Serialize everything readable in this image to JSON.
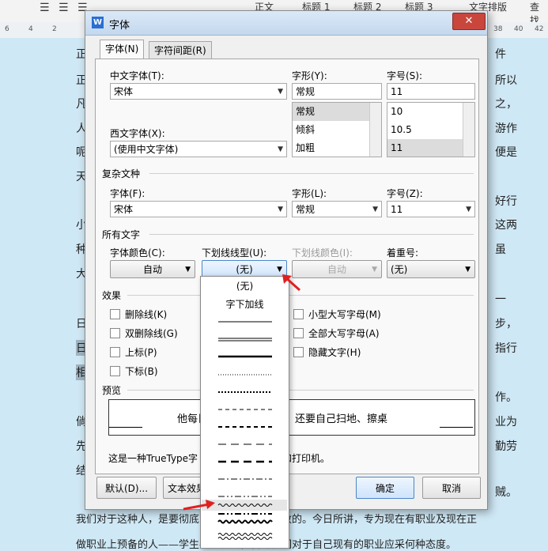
{
  "toolbar": {
    "items": [
      "正文",
      "标题 1",
      "标题 2",
      "标题 3",
      "文字排版",
      "查找"
    ]
  },
  "ruler": {
    "ticks": [
      "6",
      "4",
      "2",
      "38",
      "40",
      "42"
    ]
  },
  "document": {
    "left_lines": [
      {
        "text": "正"
      },
      {
        "text": "正"
      },
      {
        "text": "凡"
      },
      {
        "text": "人"
      },
      {
        "text": "呢"
      },
      {
        "text": "天"
      },
      {
        "text": "小"
      },
      {
        "text": "种"
      },
      {
        "text": "大"
      },
      {
        "text": "日"
      },
      {
        "text": "日"
      },
      {
        "text": "相"
      },
      {
        "text": "倘"
      },
      {
        "text": "先"
      },
      {
        "text": "结"
      }
    ],
    "right_lines": [
      "件",
      "所以",
      "之，",
      "游作",
      "便是",
      "好行",
      "这两",
      "虽",
      "一",
      "步，",
      "指行",
      "作。",
      "业为",
      "勤劳",
      "贼。"
    ],
    "bottom_line_1": "我们对于这种人，是要彻底的清算和大家要厦敦的。今日所讲，专为现在有职业及现在正",
    "bottom_line_2": "做职业上预备的人——学生——说法，告诉他们对于自己现有的职业应采何种态度。"
  },
  "dialog": {
    "title": "字体",
    "close": "✕",
    "tabs": [
      "字体(N)",
      "字符间距(R)"
    ],
    "chinese_font_label": "中文字体(T):",
    "chinese_font_value": "宋体",
    "style_label": "字形(Y):",
    "style_value": "常规",
    "style_options": [
      "常规",
      "倾斜",
      "加粗"
    ],
    "size_label": "字号(S):",
    "size_value": "11",
    "size_options": [
      "10",
      "10.5",
      "11"
    ],
    "western_font_label": "西文字体(X):",
    "western_font_value": "(使用中文字体)",
    "complex_section": "复杂文种",
    "complex_font_label": "字体(F):",
    "complex_font_value": "宋体",
    "complex_style_label": "字形(L):",
    "complex_style_value": "常规",
    "complex_size_label": "字号(Z):",
    "complex_size_value": "11",
    "all_text_section": "所有文字",
    "font_color_label": "字体颜色(C):",
    "font_color_value": "自动",
    "underline_type_label": "下划线线型(U):",
    "underline_type_value": "(无)",
    "underline_color_label": "下划线颜色(I):",
    "underline_color_value": "自动",
    "emphasis_label": "着重号:",
    "emphasis_value": "(无)",
    "effects_section": "效果",
    "effects_left": [
      "删除线(K)",
      "双删除线(G)",
      "上标(P)",
      "下标(B)"
    ],
    "effects_right": [
      "小型大写字母(M)",
      "全部大写字母(A)",
      "隐藏文字(H)"
    ],
    "preview_section": "预览",
    "preview_text": "他每日……，还要自己扫地、擦桌",
    "preview_text_left": "他每日",
    "preview_text_right": "，还要自己扫地、擦桌",
    "note_left": "这是一种TrueType字",
    "note_right": "和打印机。",
    "buttons": {
      "default": "默认(D)...",
      "text_effects": "文本效果",
      "ok": "确定",
      "cancel": "取消"
    }
  },
  "underline_dropdown": {
    "options": [
      "(无)",
      "字下加线"
    ]
  },
  "colors": {
    "accent": "#4a86c8",
    "arrow": "#e02020",
    "close": "#c9463d"
  }
}
